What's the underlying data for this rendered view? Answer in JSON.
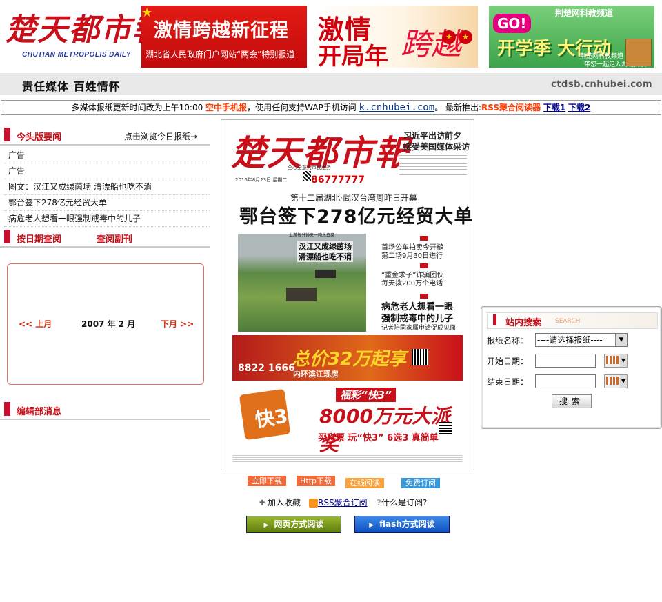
{
  "header": {
    "logo_main": "楚天都市報",
    "logo_sub": "CHUTIAN METROPOLIS DAILY",
    "banners": [
      {
        "line1": "激情跨越新征程",
        "line2": "湖北省人民政府门户网站“两会”特别报道"
      },
      {
        "word1": "激情",
        "word2": "跨越",
        "word3": "开局年"
      },
      {
        "go": "GO!",
        "channel": "荆楚网科教频道",
        "main": "开学季 大行动",
        "sub1": "荆楚网科教频道",
        "sub2": "带您一起走入湖北高校"
      }
    ],
    "slogan": "责任媒体 百姓情怀",
    "domain": "ctdsb.cnhubei.com"
  },
  "notice": {
    "text1": "多媒体报纸更新时间改为上午10:00",
    "mobile": "空中手机报",
    "text2": "，使用任何支持WAP手机访问",
    "wap": "k.cnhubei.com",
    "text3": "。 最新推出:",
    "rss": "RSS聚合阅读器",
    "dl1": "下载1",
    "dl2": "下载2"
  },
  "left": {
    "headlines_title": "今头版要闻",
    "browse_link": "点击浏览今日报纸→",
    "headlines": [
      "广告",
      "广告",
      "图文：汉江又成绿茵场 清漂船也吃不消",
      "鄂台签下278亿元经贸大单",
      "病危老人想看一眼强制戒毒中的儿子"
    ],
    "date_query_title": "按日期查阅",
    "supplement_link": "查阅副刊",
    "calendar": {
      "prev": "<<  上月",
      "month": "2007 年 2 月",
      "next": "下月  >>"
    },
    "editor_title": "编辑部消息"
  },
  "paper": {
    "masthead": "楚天都市報",
    "masthead_slogan": "全心全意为市民服务",
    "dateline": "2016年8月23日 星期二",
    "phone": "86777777",
    "side_story": [
      "习近平出访前夕",
      "接受美国媒体采访"
    ],
    "headline_sub": "第十二届湖北·武汉台湾周昨日开幕",
    "headline": "鄂台签下278亿元经贸大单",
    "photo_caption_top": "上游每分钟来一吨水白菜",
    "photo_title1": "汉江又成绿茵场",
    "photo_title2": "清漂船也吃不消",
    "right_stories": [
      "首场公车拍卖今开槌",
      "第二场9月30日进行",
      "“重金求子”诈骗团伙",
      "每天拨200万个电话",
      "病危老人想看一眼",
      "强制戒毒中的儿子",
      "记者陪同家属申请促成见面"
    ],
    "ad1_big": "总价32万起享",
    "ad1_phone": "8822 1666",
    "ad1_sub": "内环滨江现房",
    "ad2_cube": "快3",
    "ad2_top": "福彩“快3”",
    "ad2_main": "8000万元大派奖",
    "ad2_bottom": "买彩票 玩“快3” 6选3 真简单"
  },
  "actions": {
    "download": "立即下载",
    "http_download": "Http下载",
    "online_read": "在线阅读",
    "subscribe": "免费订阅",
    "favorite": "加入收藏",
    "rss_subscribe": "RSS聚合订阅",
    "what_is": "什么是订阅?",
    "web_read": "网页方式阅读",
    "flash_read": "flash方式阅读"
  },
  "search": {
    "title": "站内搜索",
    "title_en": "SEARCH",
    "paper_label": "报纸名称：",
    "paper_select": "----请选择报纸----",
    "start_label": "开始日期：",
    "end_label": "结束日期：",
    "submit": "搜索"
  }
}
